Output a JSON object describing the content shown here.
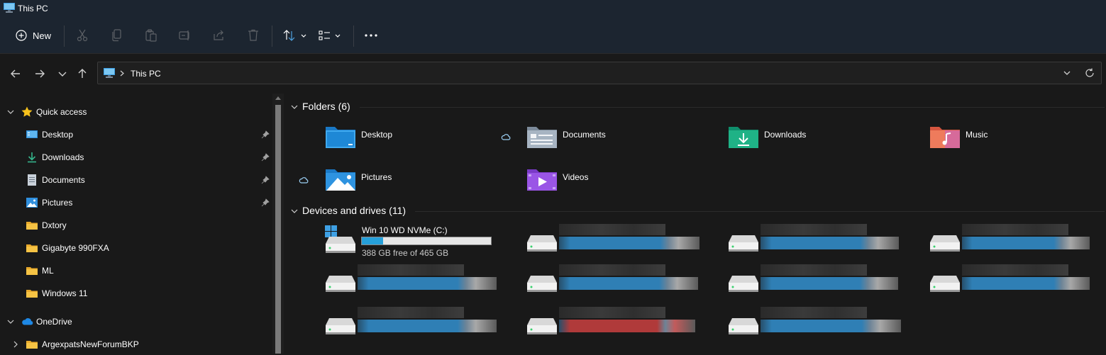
{
  "window": {
    "title": "This PC"
  },
  "commandbar": {
    "new_label": "New",
    "icons": [
      "cut-icon",
      "copy-icon",
      "paste-icon",
      "rename-icon",
      "share-icon",
      "delete-icon",
      "sort-icon",
      "view-icon",
      "more-icon"
    ]
  },
  "address": {
    "path": "This PC"
  },
  "sidebar": {
    "quick_access": "Quick access",
    "items": [
      {
        "label": "Desktop",
        "icon": "desktop-icon",
        "pinned": true
      },
      {
        "label": "Downloads",
        "icon": "downloads-icon",
        "pinned": true
      },
      {
        "label": "Documents",
        "icon": "documents-icon",
        "pinned": true
      },
      {
        "label": "Pictures",
        "icon": "pictures-icon",
        "pinned": true
      },
      {
        "label": "Dxtory",
        "icon": "folder-icon",
        "pinned": false
      },
      {
        "label": "Gigabyte 990FXA",
        "icon": "folder-icon",
        "pinned": false
      },
      {
        "label": "ML",
        "icon": "folder-icon",
        "pinned": false
      },
      {
        "label": "Windows 11",
        "icon": "folder-icon",
        "pinned": false
      }
    ],
    "onedrive": "OneDrive",
    "onedrive_child": "ArgexpatsNewForumBKP"
  },
  "content": {
    "folders_header": "Folders (6)",
    "folders": [
      {
        "label": "Desktop",
        "icon": "desktop-folder-icon"
      },
      {
        "label": "Documents",
        "icon": "documents-folder-icon"
      },
      {
        "label": "Downloads",
        "icon": "downloads-folder-icon"
      },
      {
        "label": "Music",
        "icon": "music-folder-icon"
      },
      {
        "label": "Pictures",
        "icon": "pictures-folder-icon"
      },
      {
        "label": "Videos",
        "icon": "videos-folder-icon"
      }
    ],
    "drives_header": "Devices and drives (11)",
    "system_drive": {
      "name": "Win 10 WD NVMe (C:)",
      "free": "388 GB free of 465 GB",
      "used_fraction": 0.166
    }
  },
  "colors": {
    "accent": "#26a0da",
    "warning_bar": "#b03a3a"
  }
}
